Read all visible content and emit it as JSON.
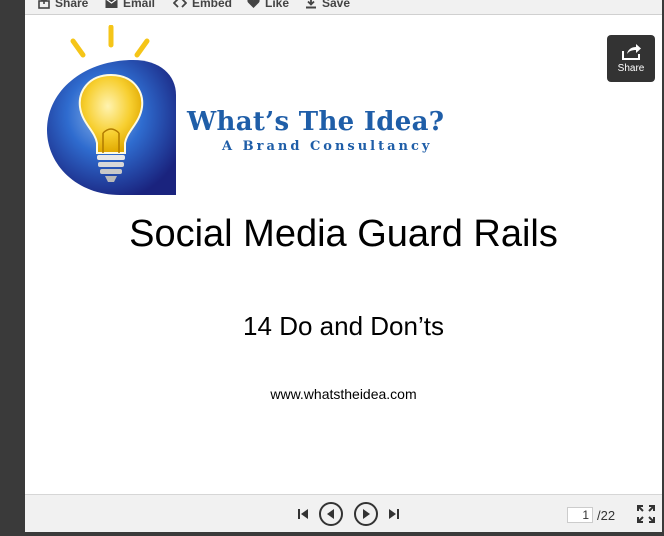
{
  "toolbar": {
    "share_label": "Share",
    "email_label": "Email",
    "embed_label": "Embed",
    "like_label": "Like",
    "save_label": "Save"
  },
  "slide": {
    "logo_title": "What’s The Idea?",
    "logo_subtitle": "A Brand Consultancy",
    "title": "Social Media Guard Rails",
    "subtitle": "14 Do and Don’ts",
    "url": "www.whatstheidea.com"
  },
  "share_overlay": {
    "label": "Share"
  },
  "pagination": {
    "current_page": "1",
    "total_pages": "/22"
  },
  "colors": {
    "brand_blue": "#1f5ea8",
    "bulb_yellow": "#f5c518",
    "dark_button": "#333333"
  }
}
